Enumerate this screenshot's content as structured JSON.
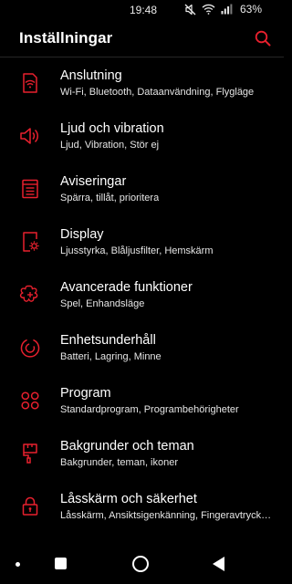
{
  "status_bar": {
    "time": "19:48",
    "battery": "63%",
    "icons": [
      "mute-icon",
      "wifi-icon",
      "signal-icon"
    ]
  },
  "app_bar": {
    "title": "Inställningar",
    "search_icon": "search-icon"
  },
  "accent_color": "#e8202e",
  "settings": [
    {
      "title": "Anslutning",
      "subtitle": "Wi-Fi, Bluetooth, Dataanvändning, Flygläge",
      "icon": "connection-icon"
    },
    {
      "title": "Ljud och vibration",
      "subtitle": "Ljud, Vibration, Stör ej",
      "icon": "sound-icon"
    },
    {
      "title": "Aviseringar",
      "subtitle": "Spärra, tillåt, prioritera",
      "icon": "notifications-icon"
    },
    {
      "title": "Display",
      "subtitle": "Ljusstyrka, Blåljusfilter, Hemskärm",
      "icon": "display-icon"
    },
    {
      "title": "Avancerade funktioner",
      "subtitle": "Spel, Enhandsläge",
      "icon": "advanced-features-icon"
    },
    {
      "title": "Enhetsunderhåll",
      "subtitle": "Batteri, Lagring, Minne",
      "icon": "device-maintenance-icon"
    },
    {
      "title": "Program",
      "subtitle": "Standardprogram, Programbehörigheter",
      "icon": "apps-icon"
    },
    {
      "title": "Bakgrunder och teman",
      "subtitle": "Bakgrunder, teman, ikoner",
      "icon": "wallpaper-brush-icon"
    },
    {
      "title": "Låsskärm och säkerhet",
      "subtitle": "Låsskärm, Ansiktsigenkänning, Fingeravtryck…",
      "icon": "lock-icon"
    }
  ],
  "nav_bar": {
    "buttons": [
      "menu-dot",
      "recents",
      "home",
      "back"
    ]
  }
}
